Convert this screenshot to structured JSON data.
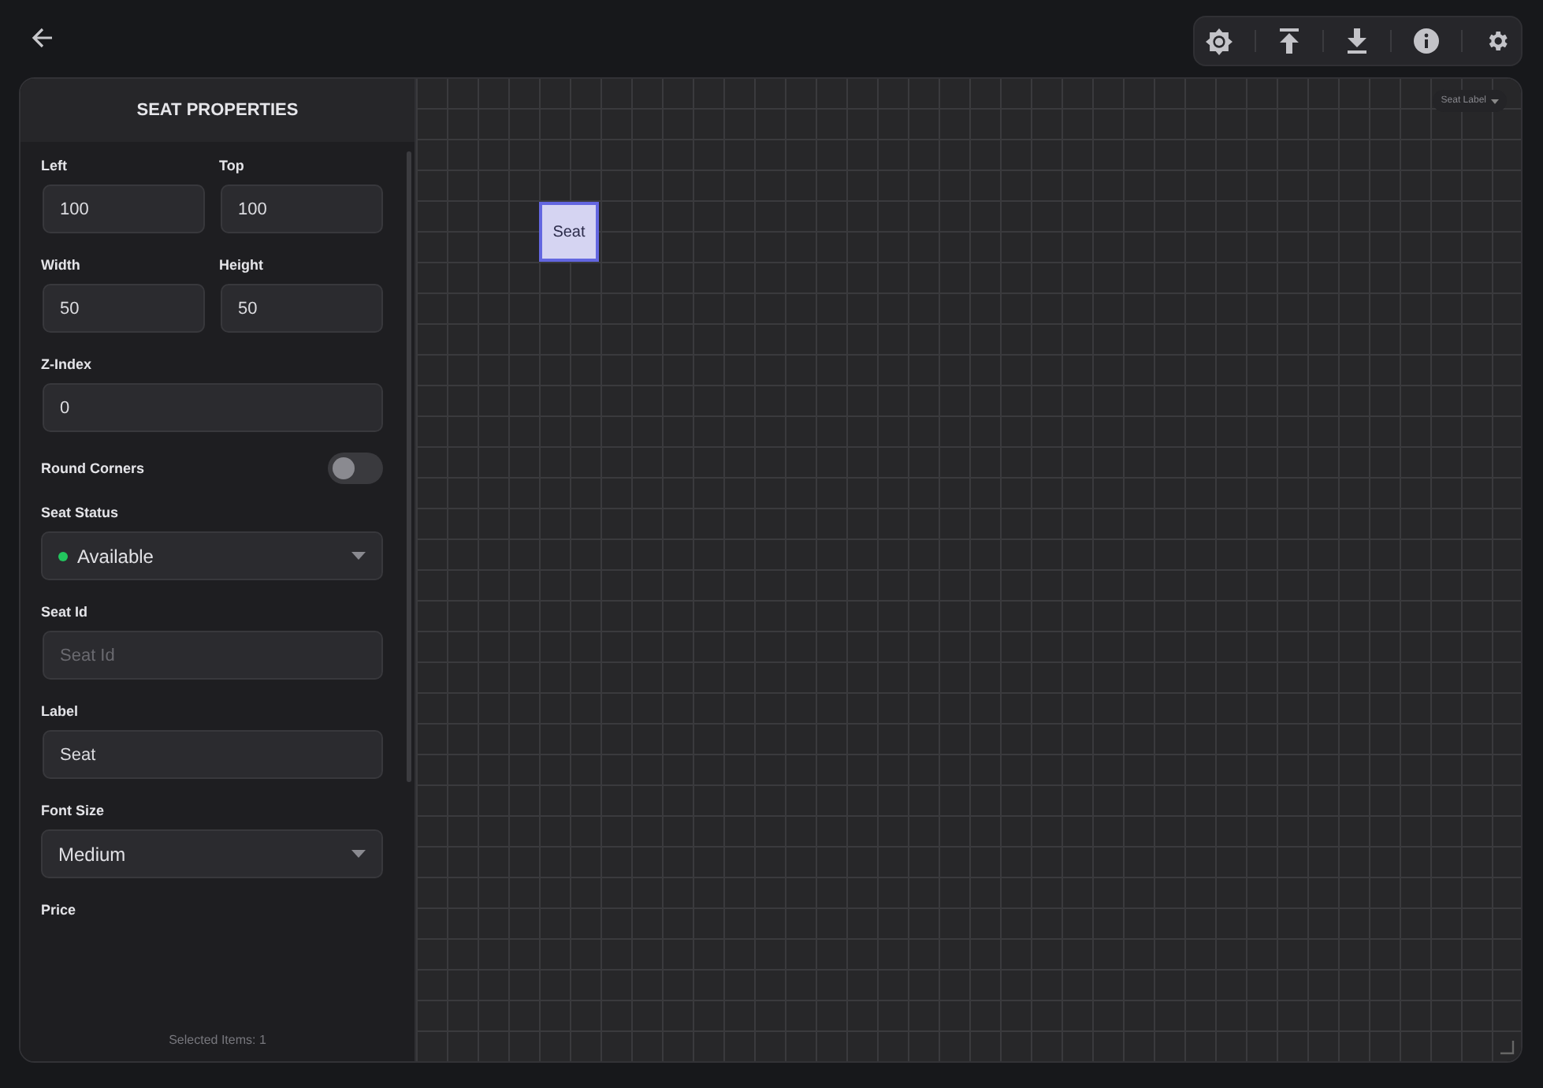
{
  "panel": {
    "title": "SEAT PROPERTIES",
    "properties": [
      {
        "kind": "pair",
        "items": [
          {
            "label": "Left",
            "value": "100"
          },
          {
            "label": "Top",
            "value": "100"
          }
        ]
      },
      {
        "kind": "pair",
        "items": [
          {
            "label": "Width",
            "value": "50"
          },
          {
            "label": "Height",
            "value": "50"
          }
        ]
      },
      {
        "kind": "text",
        "label": "Z-Index",
        "value": "0"
      },
      {
        "kind": "toggle",
        "label": "Round Corners",
        "on": false
      },
      {
        "kind": "select",
        "label": "Seat Status",
        "value": "Available",
        "color": "#22c55e"
      },
      {
        "kind": "text",
        "label": "Seat Id",
        "placeholder": "Seat Id"
      },
      {
        "kind": "text",
        "label": "Label",
        "value": "Seat"
      },
      {
        "kind": "select",
        "label": "Font Size",
        "value": "Medium"
      },
      {
        "kind": "text",
        "label": "Price"
      }
    ],
    "footer": "Selected Items: 1"
  },
  "canvas": {
    "label_menu": "Seat Label",
    "seat": {
      "label": "Seat",
      "selected": true
    }
  }
}
